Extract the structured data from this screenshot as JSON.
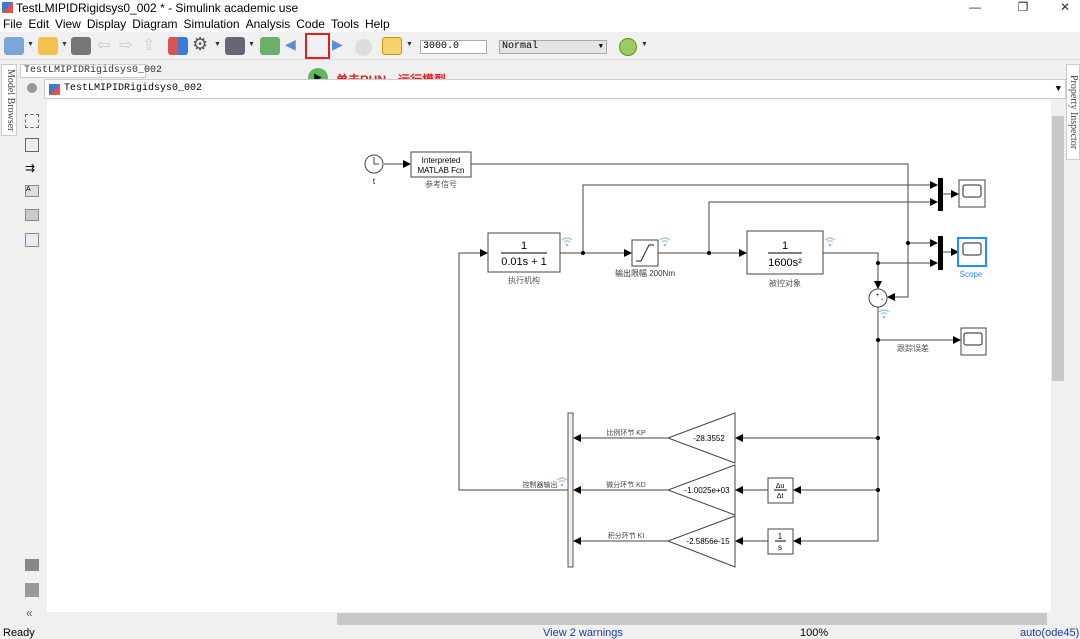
{
  "window": {
    "title": "TestLMIPIDRigidsys0_002 * - Simulink academic use"
  },
  "menu": [
    "File",
    "Edit",
    "View",
    "Display",
    "Diagram",
    "Simulation",
    "Analysis",
    "Code",
    "Tools",
    "Help"
  ],
  "toolbar": {
    "stop_time": "3000.0",
    "sim_mode": "Normal"
  },
  "annotation": "单击RUN，运行模型",
  "tabs": {
    "model_browser": "Model Browser",
    "property_inspector": "Property Inspector",
    "model_tab": "TestLMIPIDRigidsys0_002",
    "breadcrumb": "TestLMIPIDRigidsys0_002"
  },
  "diagram": {
    "clock_label": "t",
    "fcn": {
      "line1": "Interpreted",
      "line2": "MATLAB Fcn",
      "label": "参考信号"
    },
    "actuator": {
      "num": "1",
      "den": "0.01s + 1",
      "label": "执行机构"
    },
    "saturation": {
      "label": "输出限幅 200Nm"
    },
    "plant": {
      "num": "1",
      "den": "1600s²",
      "label": "被控对象"
    },
    "scope_label": "Scope",
    "error_label": "跟踪误差",
    "sum_signs": [
      "+",
      "-"
    ],
    "gains": [
      {
        "value": "-28.3552",
        "label": "比例环节 KP"
      },
      {
        "value": "-1.0025e+03",
        "label": "微分环节 KD"
      },
      {
        "value": "-2.5856e-15",
        "label": "积分环节 KI"
      }
    ],
    "derivative": {
      "num": "Δu",
      "den": "Δt"
    },
    "integrator": {
      "num": "1",
      "den": "s"
    },
    "controller_output": "控制器输出"
  },
  "status": {
    "ready": "Ready",
    "warnings": "View 2 warnings",
    "zoom": "100%",
    "solver": "auto(ode45)"
  },
  "colors": {
    "highlight": "#e02020",
    "scope_selected": "#1e90ff",
    "signal_icon": "#9cc3e6"
  }
}
